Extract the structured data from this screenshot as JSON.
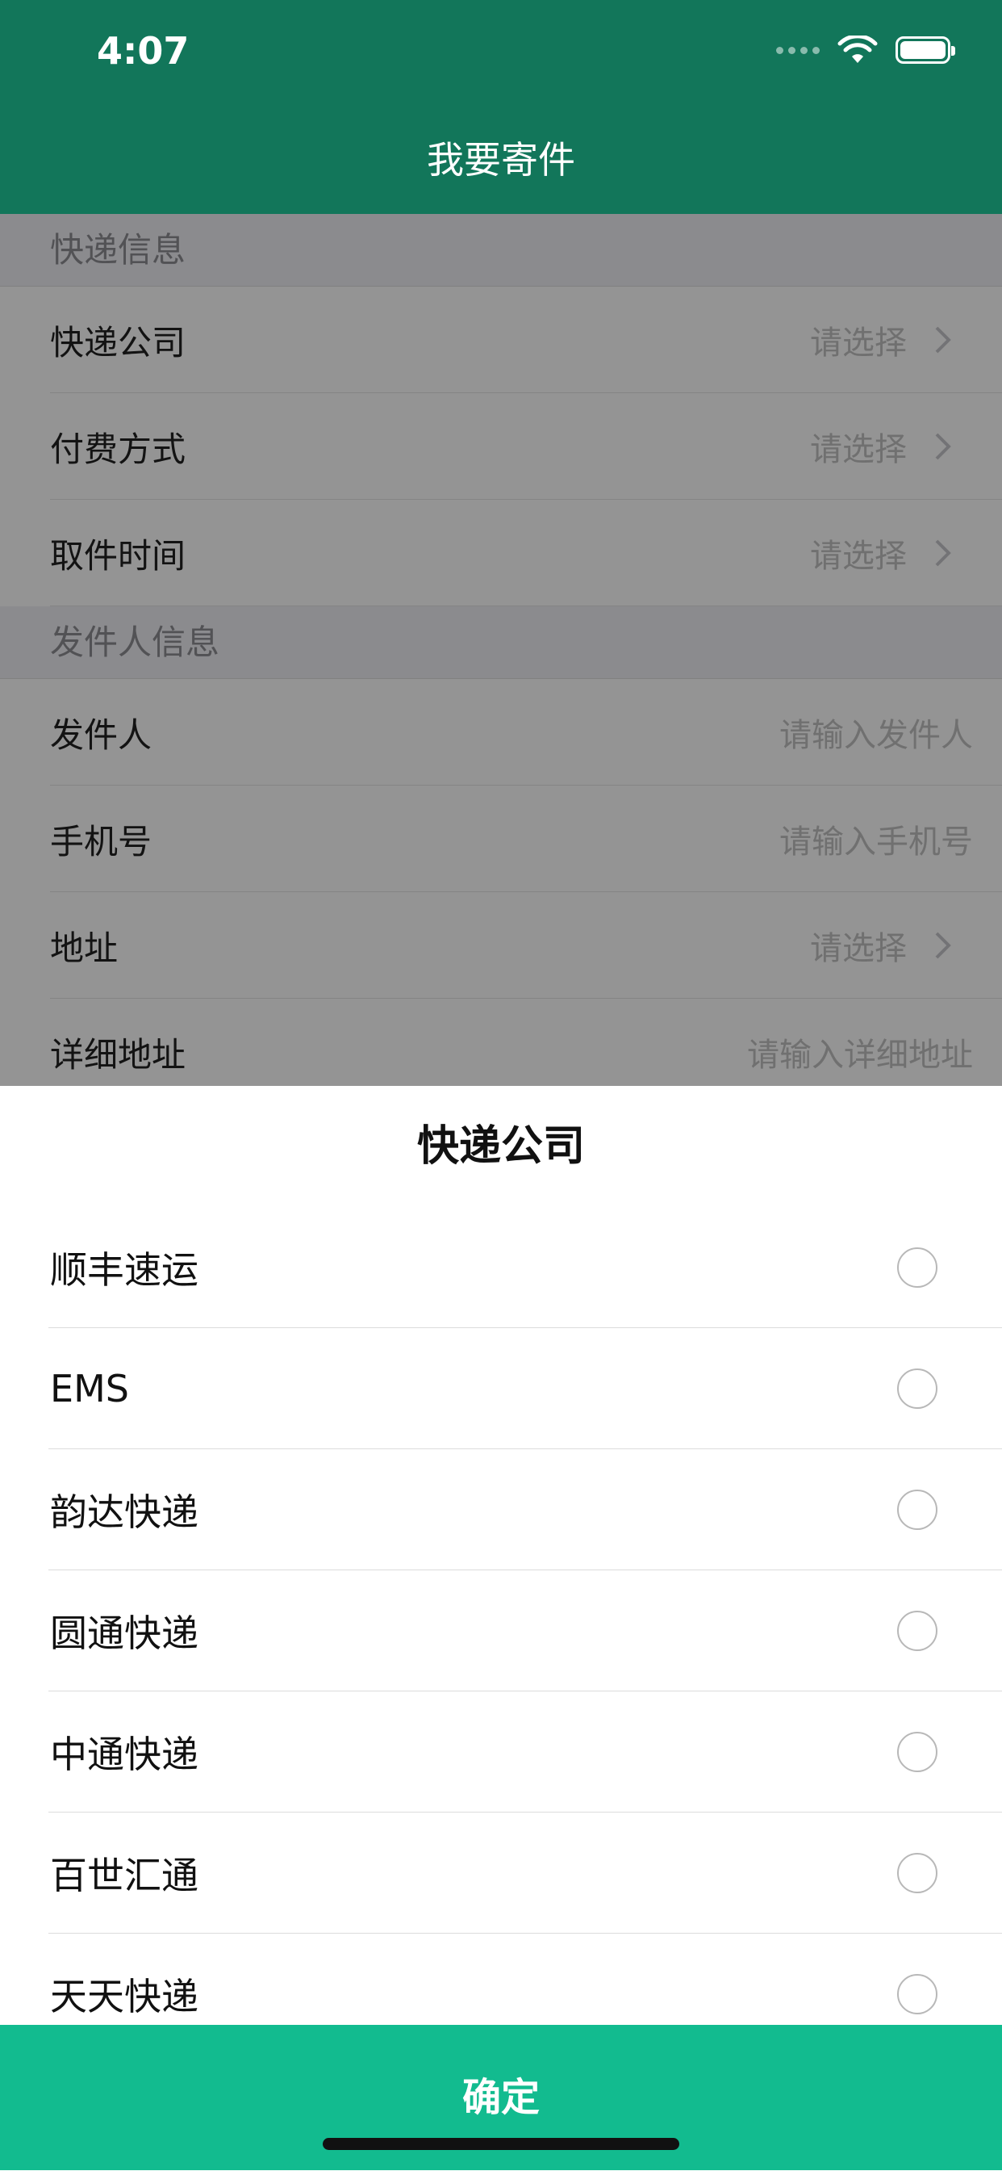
{
  "status_bar": {
    "time": "4:07"
  },
  "header": {
    "title": "我要寄件"
  },
  "form": {
    "sections": [
      {
        "title": "快递信息",
        "rows": [
          {
            "label": "快递公司",
            "value": "请选择",
            "chevron": true
          },
          {
            "label": "付费方式",
            "value": "请选择",
            "chevron": true
          },
          {
            "label": "取件时间",
            "value": "请选择",
            "chevron": true
          }
        ]
      },
      {
        "title": "发件人信息",
        "rows": [
          {
            "label": "发件人",
            "placeholder": "请输入发件人"
          },
          {
            "label": "手机号",
            "placeholder": "请输入手机号"
          },
          {
            "label": "地址",
            "value": "请选择",
            "chevron": true
          },
          {
            "label": "详细地址",
            "placeholder": "请输入详细地址"
          }
        ]
      }
    ]
  },
  "sheet": {
    "title": "快递公司",
    "options": [
      "顺丰速运",
      "EMS",
      "韵达快递",
      "圆通快递",
      "中通快递",
      "百世汇通",
      "天天快递"
    ],
    "confirm_label": "确定"
  },
  "colors": {
    "header_bg": "#12765a",
    "confirm_bg": "#12bb8f"
  },
  "icons": [
    "wifi-icon",
    "battery-icon",
    "chevron-right-icon",
    "radio-unchecked-icon"
  ]
}
